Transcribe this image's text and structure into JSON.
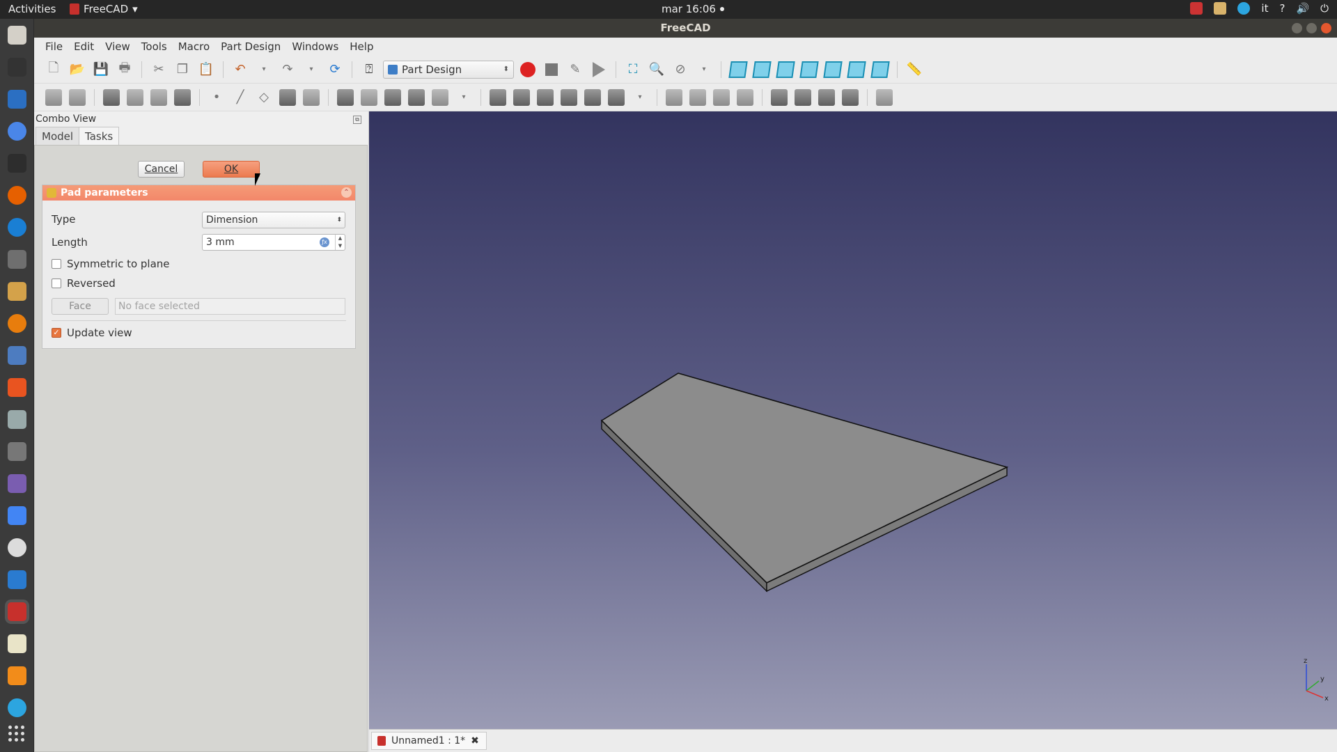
{
  "topbar": {
    "activities": "Activities",
    "app_name": "FreeCAD",
    "clock": "mar 16:06",
    "lang": "it",
    "help": "?"
  },
  "window": {
    "title": "FreeCAD"
  },
  "menubar": {
    "items": [
      "File",
      "Edit",
      "View",
      "Tools",
      "Macro",
      "Part Design",
      "Windows",
      "Help"
    ]
  },
  "toolbar": {
    "workbench": "Part Design"
  },
  "combo_view": {
    "title": "Combo View",
    "tabs": [
      "Model",
      "Tasks"
    ],
    "cancel_label": "Cancel",
    "ok_label": "OK"
  },
  "pad": {
    "title": "Pad parameters",
    "type_label": "Type",
    "type_value": "Dimension",
    "length_label": "Length",
    "length_value": "3 mm",
    "symmetric_label": "Symmetric to plane",
    "symmetric_checked": false,
    "reversed_label": "Reversed",
    "reversed_checked": false,
    "face_button": "Face",
    "face_placeholder": "No face selected",
    "update_view_label": "Update view",
    "update_view_checked": true
  },
  "axis": {
    "z": "z",
    "y": "y",
    "x": "x"
  },
  "document_tab": {
    "label": "Unnamed1 : 1*"
  },
  "colors": {
    "accent_orange": "#ec7a4f",
    "view_top": "#33345f",
    "view_bottom": "#9a9bb4",
    "solid_face": "#8c8c8c"
  }
}
